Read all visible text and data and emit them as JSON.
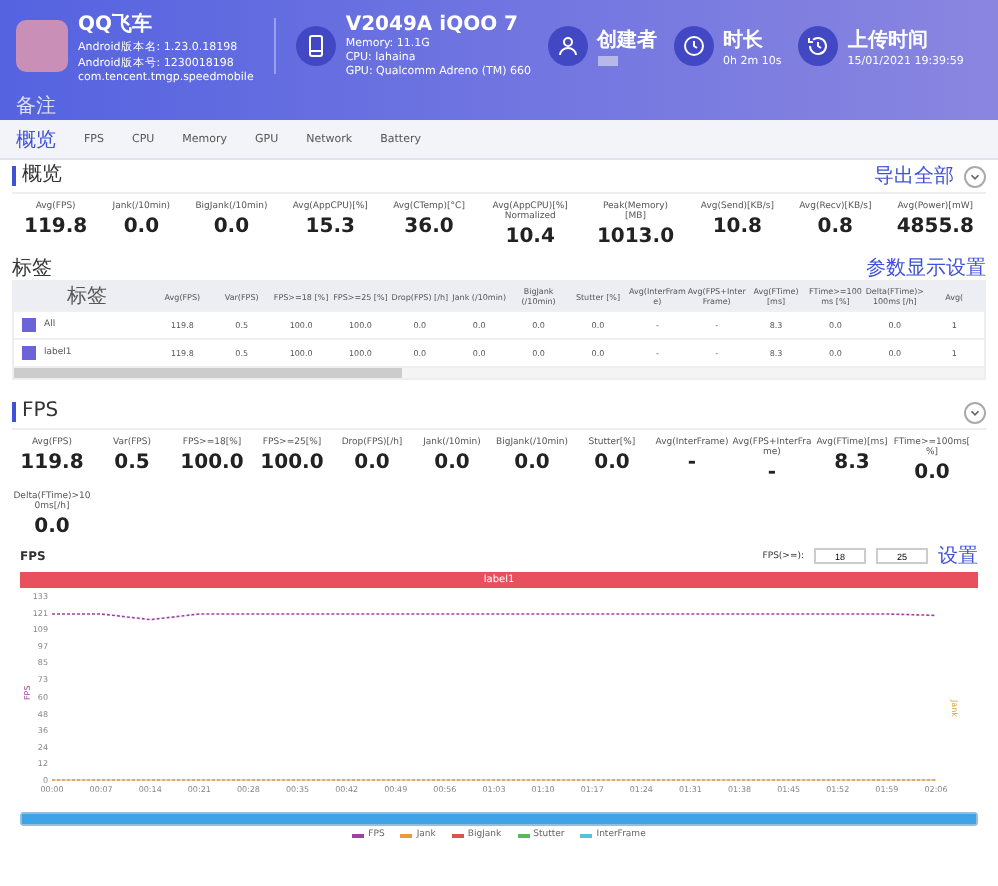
{
  "header": {
    "app": {
      "name": "QQ飞车",
      "version_name": "Android版本名: 1.23.0.18198",
      "version_code": "Android版本号: 1230018198",
      "package": "com.tencent.tmgp.speedmobile"
    },
    "device": {
      "model": "V2049A iQOO 7",
      "specs": [
        "Memory: 11.1G",
        "CPU: lahaina",
        "GPU: Qualcomm Adreno (TM) 660"
      ]
    },
    "stats": [
      {
        "kind": "creator",
        "label": "创建者"
      },
      {
        "kind": "duration",
        "label": "时长",
        "value": "0h 2m 10s"
      },
      {
        "kind": "upload",
        "label": "上传时间",
        "value": "15/01/2021 19:39:59"
      }
    ],
    "note": "备注"
  },
  "tabs": [
    {
      "label": "概览",
      "selected": true
    },
    {
      "label": "FPS",
      "selected": false
    },
    {
      "label": "CPU",
      "selected": false
    },
    {
      "label": "Memory",
      "selected": false
    },
    {
      "label": "GPU",
      "selected": false
    },
    {
      "label": "Network",
      "selected": false
    },
    {
      "label": "Battery",
      "selected": false
    }
  ],
  "overview": {
    "title": "概览",
    "action": "导出全部",
    "metrics": [
      {
        "label": "Avg(FPS)",
        "value": "119.8"
      },
      {
        "label": "Jank(/10min)",
        "value": "0.0"
      },
      {
        "label": "BigJank(/10min)",
        "value": "0.0"
      },
      {
        "label": "Avg(AppCPU)[%]",
        "value": "15.3"
      },
      {
        "label": "Avg(CTemp)[°C]",
        "value": "36.0"
      },
      {
        "label": "Avg(AppCPU)[%] Normalized",
        "value": "10.4"
      },
      {
        "label": "Peak(Memory)[MB]",
        "value": "1013.0"
      },
      {
        "label": "Avg(Send)[KB/s]",
        "value": "10.8"
      },
      {
        "label": "Avg(Recv)[KB/s]",
        "value": "0.8"
      },
      {
        "label": "Avg(Power)[mW]",
        "value": "4855.8"
      }
    ]
  },
  "labels_table": {
    "title": "标签",
    "action": "参数显示设置",
    "columns": [
      "标签",
      "Avg(FPS)",
      "Var(FPS)",
      "FPS>=18 [%]",
      "FPS>=25 [%]",
      "Drop(FPS) [/h]",
      "Jank (/10min)",
      "BigJank (/10min)",
      "Stutter [%]",
      "Avg(InterFrame)",
      "Avg(FPS+InterFrame)",
      "Avg(FTime) [ms]",
      "FTime>=100ms [%]",
      "Delta(FTime)>100ms [/h]",
      "Avg("
    ],
    "rows": [
      {
        "checked": true,
        "cells": [
          "All",
          "119.8",
          "0.5",
          "100.0",
          "100.0",
          "0.0",
          "0.0",
          "0.0",
          "0.0",
          "-",
          "-",
          "8.3",
          "0.0",
          "0.0",
          "1"
        ]
      },
      {
        "checked": true,
        "cells": [
          "label1",
          "119.8",
          "0.5",
          "100.0",
          "100.0",
          "0.0",
          "0.0",
          "0.0",
          "0.0",
          "-",
          "-",
          "8.3",
          "0.0",
          "0.0",
          "1"
        ]
      }
    ]
  },
  "fps": {
    "title": "FPS",
    "metrics": [
      {
        "label": "Avg(FPS)",
        "value": "119.8"
      },
      {
        "label": "Var(FPS)",
        "value": "0.5"
      },
      {
        "label": "FPS>=18[%]",
        "value": "100.0"
      },
      {
        "label": "FPS>=25[%]",
        "value": "100.0"
      },
      {
        "label": "Drop(FPS)[/h]",
        "value": "0.0"
      },
      {
        "label": "Jank(/10min)",
        "value": "0.0"
      },
      {
        "label": "BigJank(/10min)",
        "value": "0.0"
      },
      {
        "label": "Stutter[%]",
        "value": "0.0"
      },
      {
        "label": "Avg(InterFrame)",
        "value": "-"
      },
      {
        "label": "Avg(FPS+InterFrame)",
        "value": "-"
      },
      {
        "label": "Avg(FTime)[ms]",
        "value": "8.3"
      },
      {
        "label": "FTime>=100ms[%]",
        "value": "0.0"
      },
      {
        "label": "Delta(FTime)>100ms[/h]",
        "value": "0.0"
      }
    ]
  },
  "fps_chart": {
    "title": "FPS",
    "threshold_label": "FPS(>=):",
    "thresholds": [
      "18",
      "25"
    ],
    "button": "设置",
    "label_bar": "label1",
    "right_axis": "Jank",
    "legend": [
      "BigJank",
      "Stutter",
      "InterFrame"
    ],
    "range": {
      "level": 1
    },
    "chart_data": {
      "type": "line",
      "ylabel": "FPS",
      "x": [
        "00:00",
        "00:07",
        "00:14",
        "00:21",
        "00:28",
        "00:35",
        "00:42",
        "00:49",
        "00:56",
        "01:03",
        "01:10",
        "01:17",
        "01:24",
        "01:31",
        "01:38",
        "01:45",
        "01:52",
        "01:59",
        "02:06"
      ],
      "ylim": [
        0,
        133
      ],
      "yticks": [
        0,
        12,
        24,
        36,
        48,
        60,
        73,
        85,
        97,
        109,
        121,
        133
      ],
      "series": [
        {
          "name": "FPS",
          "color": "#a040a0",
          "line_style": "dashed",
          "values": [
            120,
            120,
            116,
            120,
            120,
            120,
            120,
            120,
            120,
            120,
            120,
            120,
            120,
            120,
            120,
            120,
            120,
            120,
            119
          ]
        },
        {
          "name": "Jank",
          "color": "#e89a3c",
          "line_style": "dashed",
          "values": [
            0,
            0,
            0,
            0,
            0,
            0,
            0,
            0,
            0,
            0,
            0,
            0,
            0,
            0,
            0,
            0,
            0,
            0,
            0
          ]
        }
      ]
    }
  }
}
